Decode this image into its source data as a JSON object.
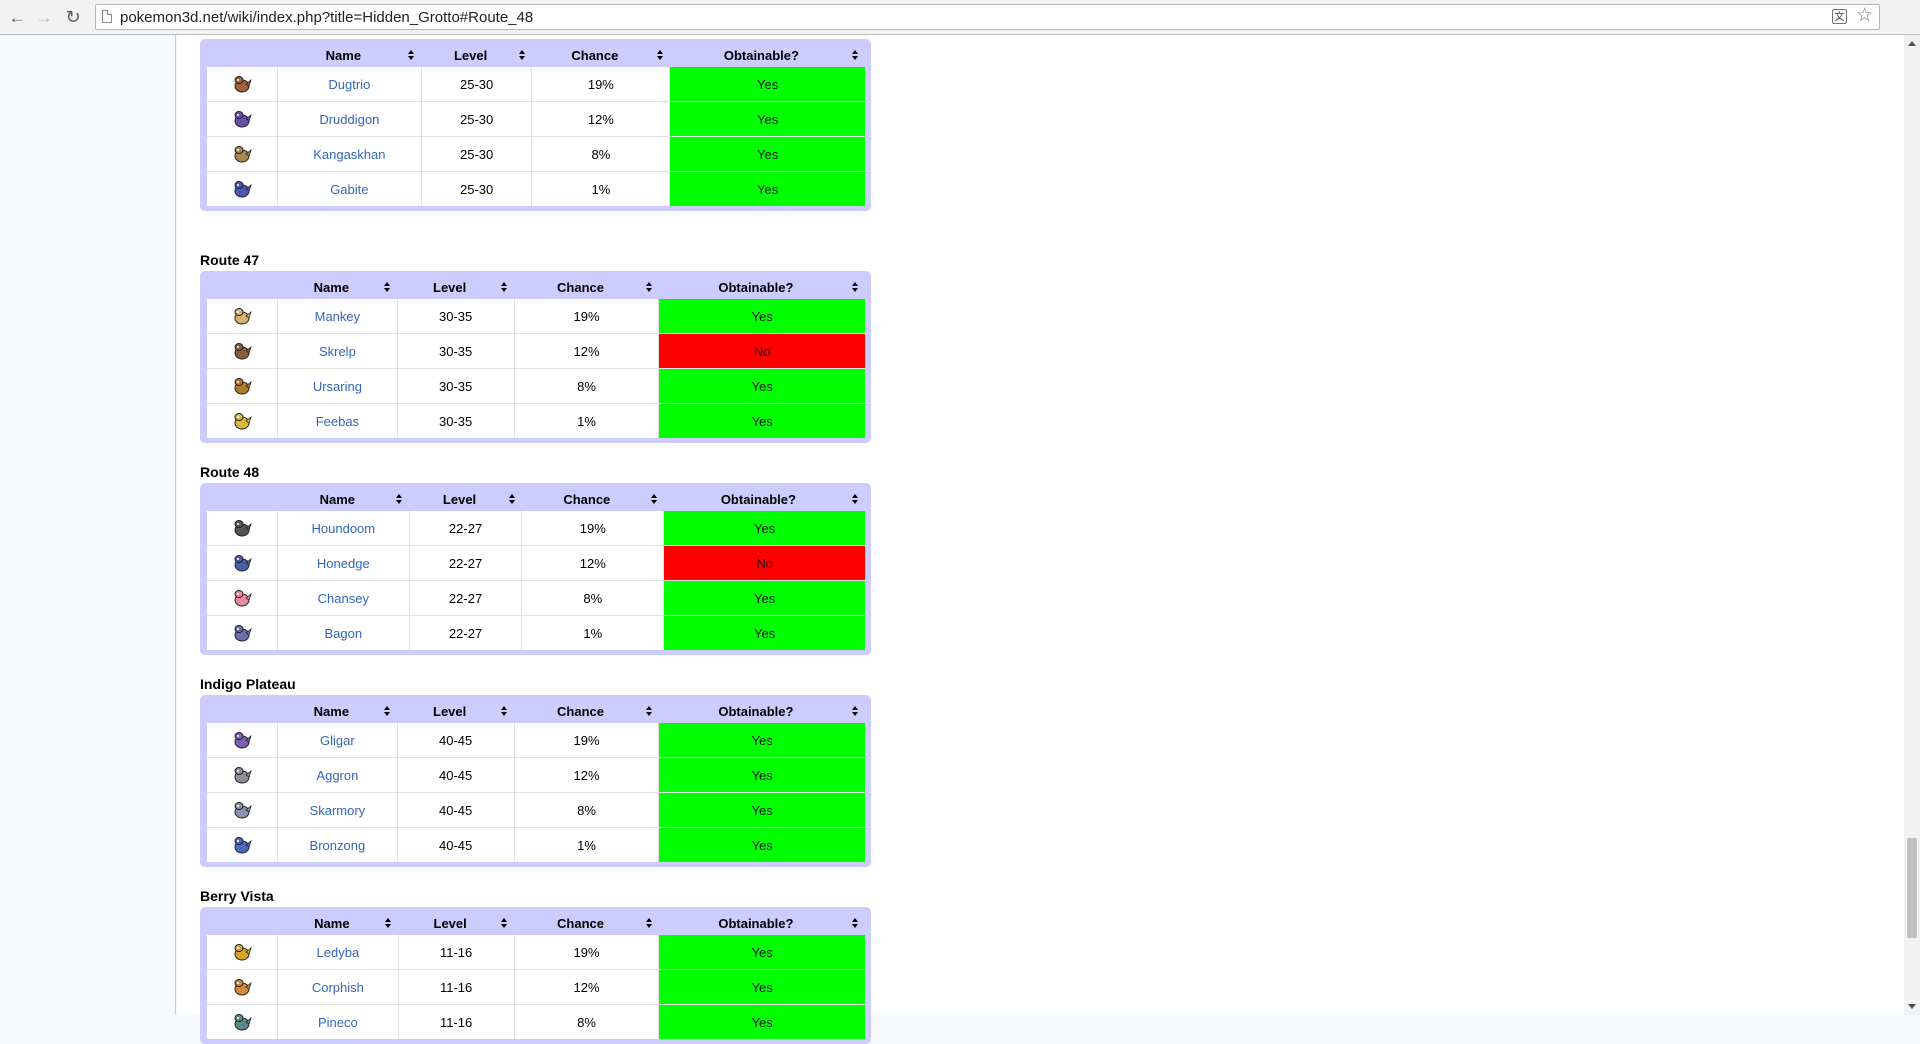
{
  "browser": {
    "url": "pokemon3d.net/wiki/index.php?title=Hidden_Grotto#Route_48",
    "translate_icon_glyph": "文",
    "star_glyph": "☆"
  },
  "colors": {
    "header_bg": "#ccccff",
    "frame_bg": "#ccccff",
    "yes": "#00ff00",
    "no": "#ff0000",
    "link": "#3366bb"
  },
  "tables": [
    {
      "title": "",
      "headers": {
        "name": "Name",
        "level": "Level",
        "chance": "Chance",
        "obtainable": "Obtainable?"
      },
      "rows": [
        {
          "icon": "dugtrio-sprite-icon",
          "name": "Dugtrio",
          "level": "25-30",
          "chance": "19%",
          "obtainable": "Yes"
        },
        {
          "icon": "druddigon-sprite-icon",
          "name": "Druddigon",
          "level": "25-30",
          "chance": "12%",
          "obtainable": "Yes"
        },
        {
          "icon": "kangaskhan-sprite-icon",
          "name": "Kangaskhan",
          "level": "25-30",
          "chance": "8%",
          "obtainable": "Yes"
        },
        {
          "icon": "gabite-sprite-icon",
          "name": "Gabite",
          "level": "25-30",
          "chance": "1%",
          "obtainable": "Yes"
        }
      ]
    },
    {
      "title": "Route 47",
      "headers": {
        "name": "Name",
        "level": "Level",
        "chance": "Chance",
        "obtainable": "Obtainable?"
      },
      "rows": [
        {
          "icon": "mankey-sprite-icon",
          "name": "Mankey",
          "level": "30-35",
          "chance": "19%",
          "obtainable": "Yes"
        },
        {
          "icon": "skrelp-sprite-icon",
          "name": "Skrelp",
          "level": "30-35",
          "chance": "12%",
          "obtainable": "No"
        },
        {
          "icon": "ursaring-sprite-icon",
          "name": "Ursaring",
          "level": "30-35",
          "chance": "8%",
          "obtainable": "Yes"
        },
        {
          "icon": "feebas-sprite-icon",
          "name": "Feebas",
          "level": "30-35",
          "chance": "1%",
          "obtainable": "Yes"
        }
      ]
    },
    {
      "title": "Route 48",
      "headers": {
        "name": "Name",
        "level": "Level",
        "chance": "Chance",
        "obtainable": "Obtainable?"
      },
      "rows": [
        {
          "icon": "houndoom-sprite-icon",
          "name": "Houndoom",
          "level": "22-27",
          "chance": "19%",
          "obtainable": "Yes"
        },
        {
          "icon": "honedge-sprite-icon",
          "name": "Honedge",
          "level": "22-27",
          "chance": "12%",
          "obtainable": "No"
        },
        {
          "icon": "chansey-sprite-icon",
          "name": "Chansey",
          "level": "22-27",
          "chance": "8%",
          "obtainable": "Yes"
        },
        {
          "icon": "bagon-sprite-icon",
          "name": "Bagon",
          "level": "22-27",
          "chance": "1%",
          "obtainable": "Yes"
        }
      ]
    },
    {
      "title": "Indigo Plateau",
      "headers": {
        "name": "Name",
        "level": "Level",
        "chance": "Chance",
        "obtainable": "Obtainable?"
      },
      "rows": [
        {
          "icon": "gligar-sprite-icon",
          "name": "Gligar",
          "level": "40-45",
          "chance": "19%",
          "obtainable": "Yes"
        },
        {
          "icon": "aggron-sprite-icon",
          "name": "Aggron",
          "level": "40-45",
          "chance": "12%",
          "obtainable": "Yes"
        },
        {
          "icon": "skarmory-sprite-icon",
          "name": "Skarmory",
          "level": "40-45",
          "chance": "8%",
          "obtainable": "Yes"
        },
        {
          "icon": "bronzong-sprite-icon",
          "name": "Bronzong",
          "level": "40-45",
          "chance": "1%",
          "obtainable": "Yes"
        }
      ]
    },
    {
      "title": "Berry Vista",
      "headers": {
        "name": "Name",
        "level": "Level",
        "chance": "Chance",
        "obtainable": "Obtainable?"
      },
      "rows": [
        {
          "icon": "ledyba-sprite-icon",
          "name": "Ledyba",
          "level": "11-16",
          "chance": "19%",
          "obtainable": "Yes"
        },
        {
          "icon": "corphish-sprite-icon",
          "name": "Corphish",
          "level": "11-16",
          "chance": "12%",
          "obtainable": "Yes"
        },
        {
          "icon": "pineco-sprite-icon",
          "name": "Pineco",
          "level": "11-16",
          "chance": "8%",
          "obtainable": "Yes"
        }
      ]
    }
  ]
}
